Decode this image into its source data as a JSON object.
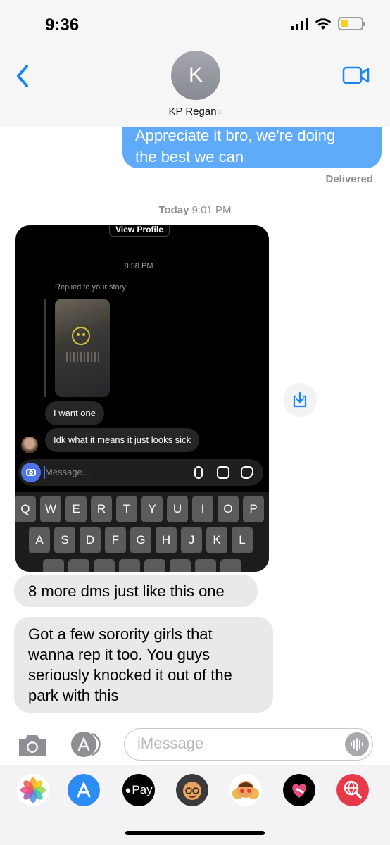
{
  "status_bar": {
    "time": "9:36"
  },
  "header": {
    "avatar_initial": "K",
    "contact_name": "KP Regan",
    "chevron": "›"
  },
  "messages": {
    "outgoing": {
      "text_lines": [
        "Appreciate it bro, we're doing",
        "the best we can"
      ],
      "status": "Delivered"
    },
    "timestamp_day": "Today",
    "timestamp_time": "9:01 PM",
    "incoming": [
      {
        "text": "8 more dms just like this one"
      },
      {
        "text": "Got a few sorority girls that wanna rep it too. You guys seriously knocked it out of the park with this"
      }
    ]
  },
  "screenshot": {
    "view_profile": "View Profile",
    "time": "8:58 PM",
    "replied_label": "Replied to your story",
    "bubbles": [
      "I want one",
      "Idk what it means it just looks sick"
    ],
    "input_placeholder": "Message...",
    "keyboard_row1": [
      "Q",
      "W",
      "E",
      "R",
      "T",
      "Y",
      "U",
      "I",
      "O",
      "P"
    ],
    "keyboard_row2": [
      "A",
      "S",
      "D",
      "F",
      "G",
      "H",
      "J",
      "K",
      "L"
    ]
  },
  "input_bar": {
    "placeholder": "iMessage"
  },
  "app_drawer": {
    "apps": [
      {
        "icon": "photos-icon"
      },
      {
        "icon": "app-store-icon"
      },
      {
        "icon": "apple-pay-icon",
        "label": "Pay"
      },
      {
        "icon": "memoji-icon"
      },
      {
        "icon": "memoji-stickers-icon"
      },
      {
        "icon": "digital-touch-icon"
      },
      {
        "icon": "web-search-icon"
      }
    ]
  },
  "colors": {
    "outgoing_bubble": "#5fabf9",
    "incoming_bubble": "#e9e9eb",
    "accent": "#1a84ff"
  }
}
